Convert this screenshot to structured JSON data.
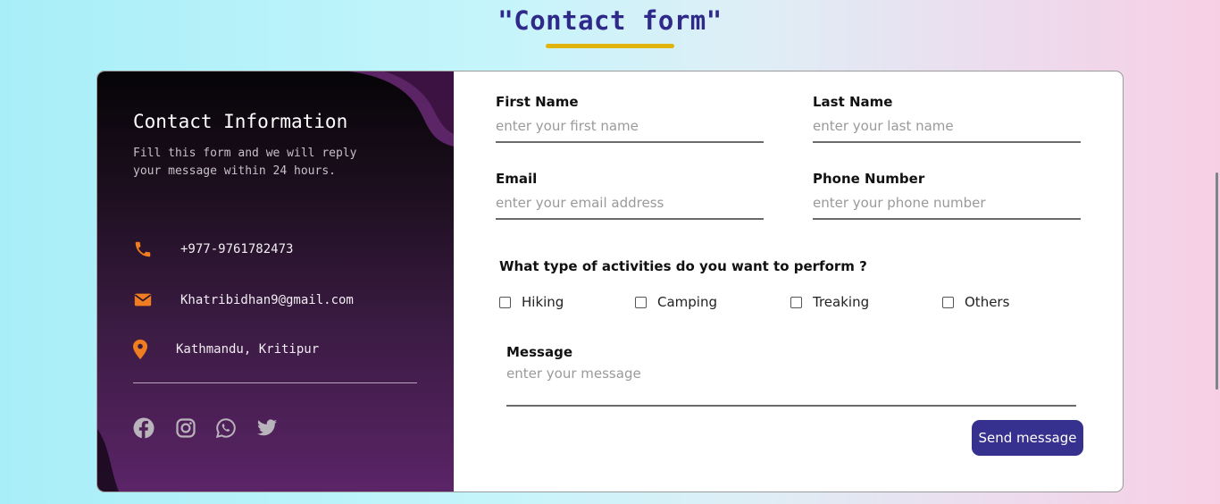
{
  "page": {
    "title": "\"Contact form\"",
    "colors": {
      "accent": "#e0b40c",
      "brand": "#36308f",
      "icon": "#f07d1f"
    }
  },
  "info": {
    "title": "Contact Information",
    "subtitle": "Fill this form and we will reply your message within 24 hours.",
    "contacts": [
      {
        "icon": "phone-icon",
        "text": "+977-9761782473"
      },
      {
        "icon": "mail-icon",
        "text": "Khatribidhan9@gmail.com"
      },
      {
        "icon": "location-pin-icon",
        "text": "Kathmandu, Kritipur"
      }
    ],
    "social": [
      "facebook-icon",
      "instagram-icon",
      "whatsapp-icon",
      "twitter-icon"
    ]
  },
  "form": {
    "first_name": {
      "label": "First Name",
      "placeholder": "enter your first name",
      "value": ""
    },
    "last_name": {
      "label": "Last Name",
      "placeholder": "enter your last name",
      "value": ""
    },
    "email": {
      "label": "Email",
      "placeholder": "enter your email address",
      "value": ""
    },
    "phone": {
      "label": "Phone Number",
      "placeholder": "enter your phone number",
      "value": ""
    },
    "question": "What type of activities do you want to perform ?",
    "activities": [
      {
        "label": "Hiking",
        "checked": false
      },
      {
        "label": "Camping",
        "checked": false
      },
      {
        "label": "Treaking",
        "checked": false
      },
      {
        "label": "Others",
        "checked": false
      }
    ],
    "message": {
      "label": "Message",
      "placeholder": "enter your message",
      "value": ""
    },
    "send_label": "Send message"
  }
}
